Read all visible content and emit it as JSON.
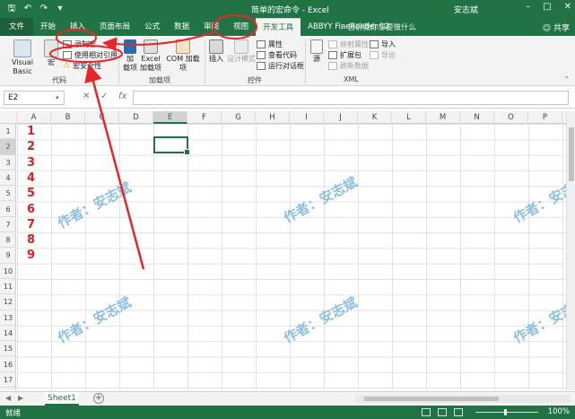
{
  "window": {
    "title": "简单的宏命令 - Excel",
    "user": "安志斌",
    "quick_access": [
      "save-icon",
      "undo-icon",
      "redo-icon",
      "customize-icon"
    ],
    "controls": [
      "minimize-icon",
      "restore-icon",
      "close-icon"
    ]
  },
  "tabs": [
    {
      "label": "文件"
    },
    {
      "label": "开始"
    },
    {
      "label": "插入"
    },
    {
      "label": "页面布局"
    },
    {
      "label": "公式"
    },
    {
      "label": "数据"
    },
    {
      "label": "审阅"
    },
    {
      "label": "视图"
    },
    {
      "label": "开发工具"
    },
    {
      "label": "ABBYY FineReader 12"
    }
  ],
  "active_tab": "开发工具",
  "tell_me": "告诉我你想要做什么",
  "share": "共享",
  "ribbon": {
    "code": {
      "label": "代码",
      "visual_basic": "Visual Basic",
      "macros": "宏",
      "record_macro": "录制宏",
      "relative_ref": "使用相对引用",
      "macro_security": "宏安全性"
    },
    "addins": {
      "label": "加载项",
      "addins": "加\n载项",
      "excel_addins": "Excel\n加载项",
      "com_addins": "COM 加载项"
    },
    "controls": {
      "label": "控件",
      "insert": "插入",
      "design_mode": "设计模式",
      "properties": "属性",
      "view_code": "查看代码",
      "run_dialog": "运行对话框"
    },
    "xml": {
      "label": "XML",
      "source": "源",
      "map_properties": "映射属性",
      "expansion_packs": "扩展包",
      "refresh_data": "刷新数据",
      "import": "导入",
      "export": "导出"
    }
  },
  "formula_bar": {
    "name_box": "E2",
    "cancel": "✕",
    "enter": "✓",
    "fx": "fx",
    "value": ""
  },
  "grid": {
    "columns": [
      "A",
      "B",
      "C",
      "D",
      "E",
      "F",
      "G",
      "H",
      "I",
      "J",
      "K",
      "L",
      "M",
      "N",
      "O",
      "P"
    ],
    "rows": [
      "1",
      "2",
      "3",
      "4",
      "5",
      "6",
      "7",
      "8",
      "9",
      "10",
      "11",
      "12",
      "13",
      "14",
      "15",
      "16",
      "17"
    ],
    "selected_cell": "E2",
    "column_a_values": [
      "1",
      "2",
      "3",
      "4",
      "5",
      "6",
      "7",
      "8",
      "9"
    ],
    "watermark": "作者：安志斌"
  },
  "sheets": [
    {
      "label": "Sheet1"
    }
  ],
  "add_sheet": "+",
  "status": {
    "ready": "就绪",
    "zoom": "100%"
  },
  "colors": {
    "excel_green": "#217346",
    "annotation_red": "#e8262a",
    "number_red": "#e02020",
    "watermark_blue": "#7ab4e0"
  }
}
